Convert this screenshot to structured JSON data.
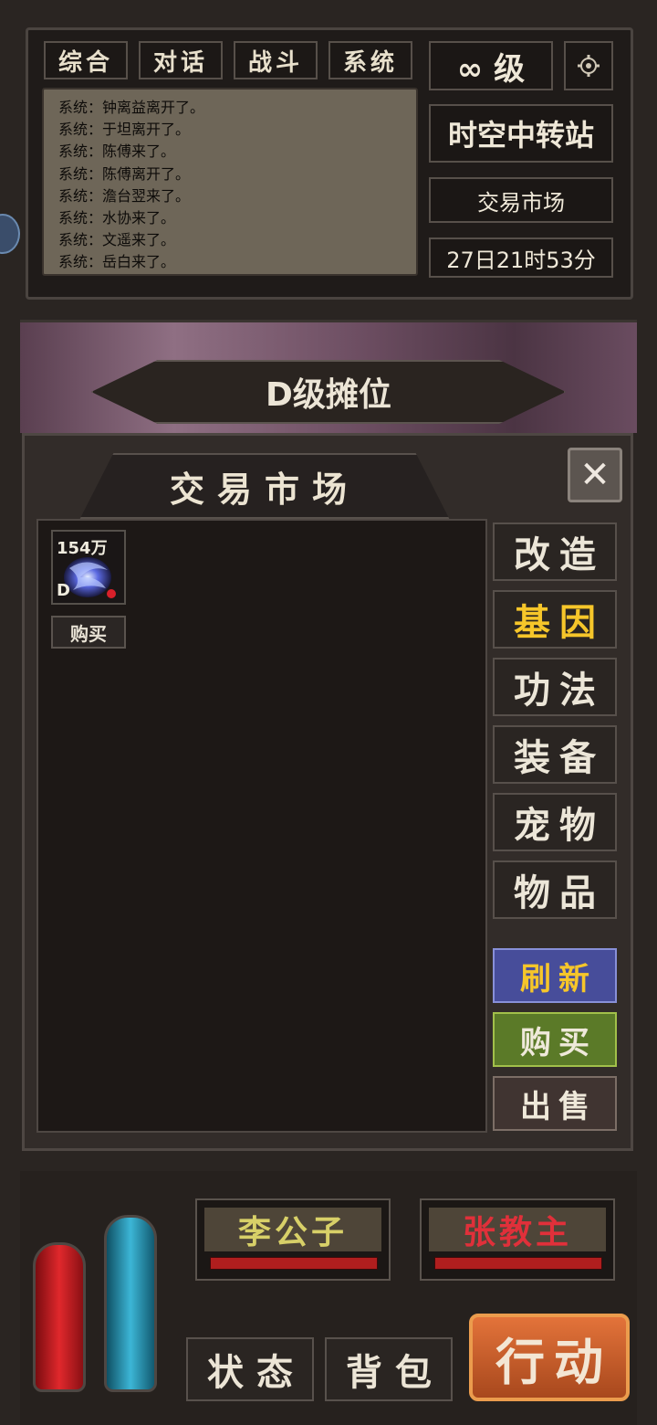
{
  "chat": {
    "tabs": [
      "综合",
      "对话",
      "战斗",
      "系统"
    ],
    "messages": [
      "系统：钟离益离开了。",
      "系统：于坦离开了。",
      "系统：陈傅来了。",
      "系统：陈傅离开了。",
      "系统：澹台翌来了。",
      "系统：水协来了。",
      "系统：文遥来了。",
      "系统：岳白来了。"
    ]
  },
  "status": {
    "level": "∞ 级",
    "location": "时空中转站",
    "sub_location": "交易市场",
    "time": "27日21时53分"
  },
  "banner": {
    "title": "D级摊位"
  },
  "market": {
    "title": "交易市场",
    "item": {
      "price": "154万",
      "grade": "D",
      "buy_label": "购买"
    },
    "categories": [
      "改造",
      "基因",
      "功法",
      "装备",
      "宠物",
      "物品"
    ],
    "active_category": "基因",
    "actions": {
      "refresh": "刷新",
      "buy": "购买",
      "sell": "出售"
    }
  },
  "players": [
    {
      "name": "李公子",
      "color": "#d8d068"
    },
    {
      "name": "张教主",
      "color": "#e0303a"
    }
  ],
  "bottom": {
    "status_label": "状态",
    "bag_label": "背包",
    "action_label": "行动"
  },
  "colors": {
    "accent": "#f6c62a",
    "refresh": "#4a4f9c",
    "buy": "#5e7c2a",
    "sell": "#4a3a34"
  }
}
